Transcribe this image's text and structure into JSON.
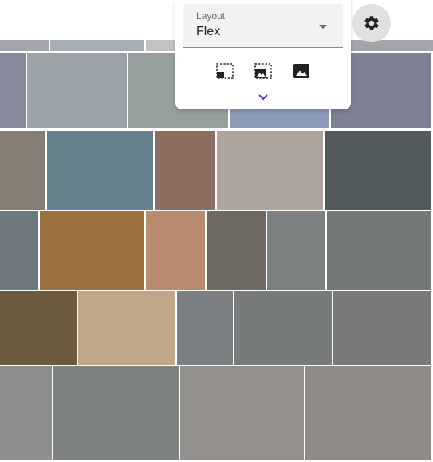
{
  "layout_select": {
    "label": "Layout",
    "value": "Flex"
  },
  "size_options": [
    {
      "name": "small-image-icon"
    },
    {
      "name": "medium-image-icon"
    },
    {
      "name": "large-image-icon"
    }
  ],
  "expand": {
    "icon": "chevron-down-icon",
    "color": "#6a1fd6"
  },
  "settings": {
    "icon": "gear-icon"
  },
  "tile_rows": [
    {
      "colors": [
        "#a4a6ad",
        "#a8acb4",
        "#c0c2c6",
        "#a3a5ab"
      ]
    },
    {
      "colors": [
        "#868a9b",
        "#9ba2a8",
        "#969f9e",
        "#8a9cb7",
        "#7e8192"
      ]
    },
    {
      "colors": [
        "#867e73",
        "#68818e",
        "#8c6d5f",
        "#afa59c",
        "#535a5c"
      ]
    },
    {
      "colors": [
        "#6d787f",
        "#9b723e",
        "#b88b6e",
        "#6e6961",
        "#7c8080",
        "#747878"
      ]
    },
    {
      "colors": [
        "#6c5a3e",
        "#c0a887",
        "#7b7f82",
        "#777b7a",
        "#777a78"
      ]
    },
    {
      "colors": [
        "#8e8e8e",
        "#7c8081",
        "#928f8d",
        "#8f8a87"
      ]
    }
  ]
}
